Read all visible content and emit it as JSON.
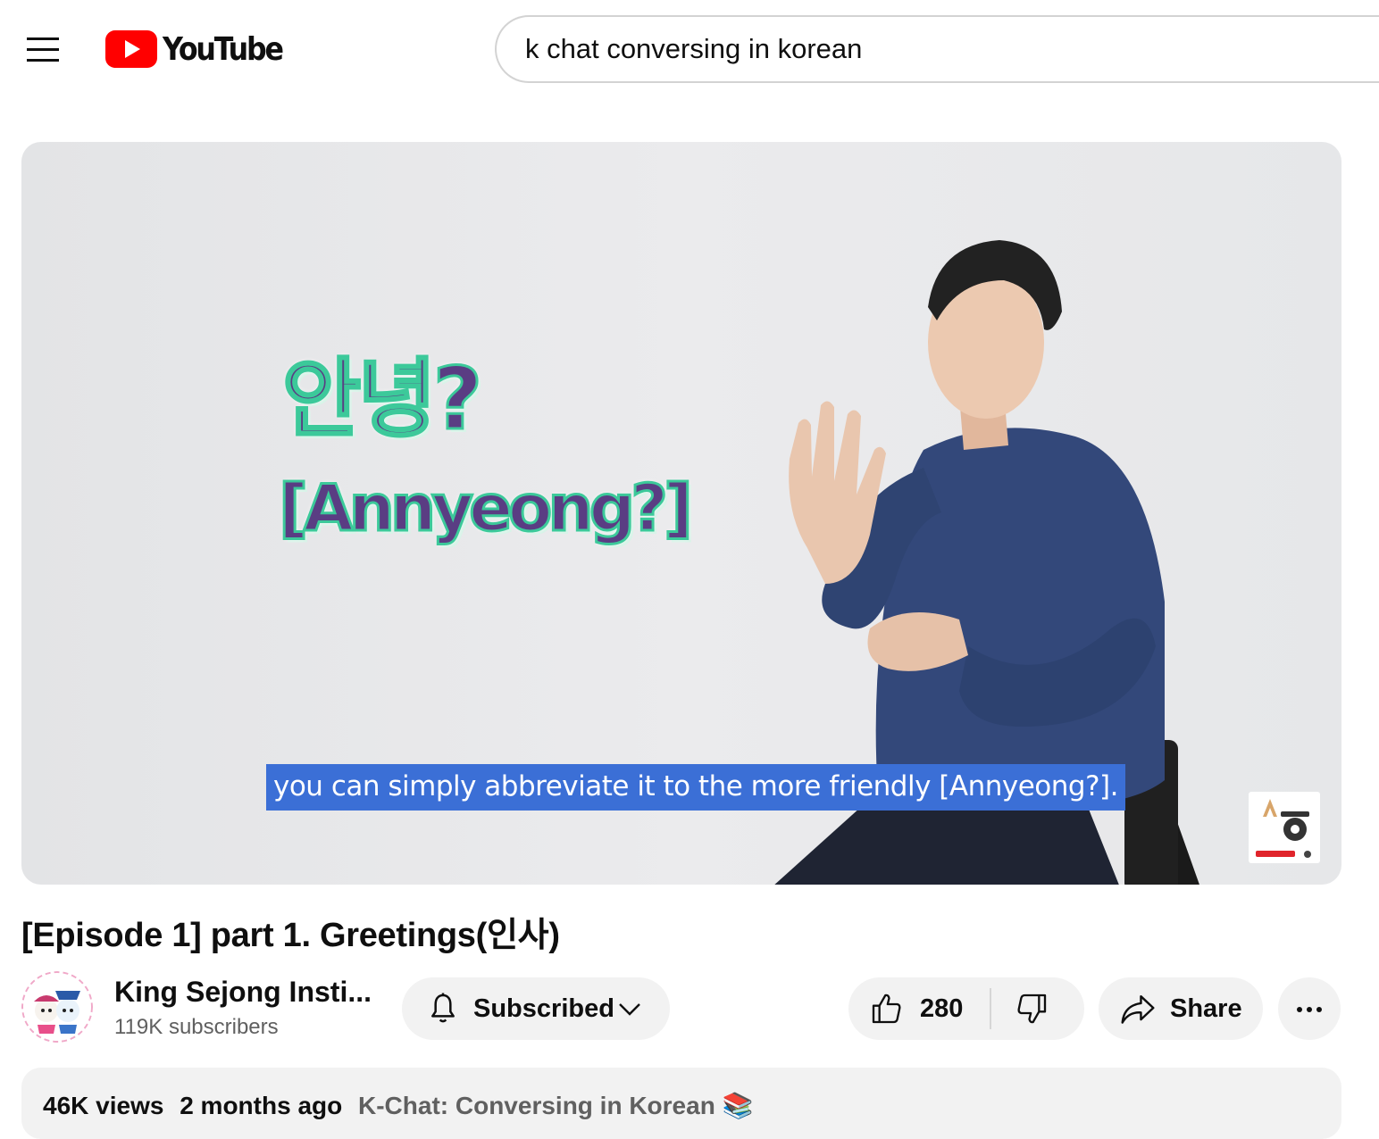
{
  "header": {
    "brand": "YouTube",
    "search_value": "k chat conversing in korean"
  },
  "player": {
    "overlay_hangul": "안녕?",
    "overlay_romanization": "[Annyeong?]",
    "caption": "you can simply abbreviate it to the more friendly [Annyeong?]."
  },
  "video": {
    "title": "[Episode 1] part 1. Greetings(인사)"
  },
  "channel": {
    "name": "King Sejong Insti...",
    "subscribers": "119K subscribers"
  },
  "actions": {
    "subscribe_label": "Subscribed",
    "like_count": "280",
    "share_label": "Share"
  },
  "description": {
    "views": "46K views",
    "date": "2 months ago",
    "playlist": "K-Chat: Conversing in Korean 📚"
  },
  "colors": {
    "brand_red": "#ff0000",
    "caption_bg": "#3b6fd6",
    "overlay_text": "#5a3d83",
    "overlay_outline": "#3cc99a",
    "chip_bg": "#f2f2f2"
  },
  "icons": [
    "menu-icon",
    "youtube-logo-icon",
    "bell-icon",
    "chevron-down-icon",
    "thumbs-up-icon",
    "thumbs-down-icon",
    "share-arrow-icon",
    "more-horizontal-icon"
  ]
}
